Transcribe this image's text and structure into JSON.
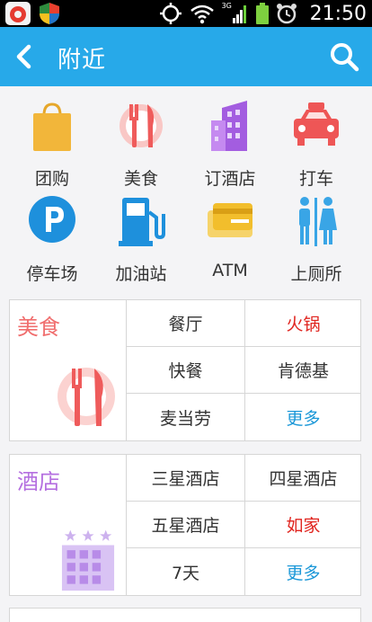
{
  "status_bar": {
    "time": "21:50",
    "network": "3G"
  },
  "title_bar": {
    "title": "附近"
  },
  "shortcuts": [
    {
      "label": "团购",
      "icon": "shopping-bag-icon"
    },
    {
      "label": "美食",
      "icon": "cutlery-icon"
    },
    {
      "label": "订酒店",
      "icon": "building-icon"
    },
    {
      "label": "打车",
      "icon": "taxi-icon"
    },
    {
      "label": "停车场",
      "icon": "parking-icon"
    },
    {
      "label": "加油站",
      "icon": "gas-station-icon"
    },
    {
      "label": "ATM",
      "icon": "atm-card-icon"
    },
    {
      "label": "上厕所",
      "icon": "restroom-icon"
    }
  ],
  "food": {
    "title": "美食",
    "items": [
      "餐厅",
      "火锅",
      "快餐",
      "肯德基",
      "麦当劳",
      "更多"
    ]
  },
  "hotel": {
    "title": "酒店",
    "items": [
      "三星酒店",
      "四星酒店",
      "五星酒店",
      "如家",
      "7天",
      "更多"
    ]
  },
  "colors": {
    "primary": "#27a9e9",
    "food": "#f06e6e",
    "hotel": "#b570e0",
    "hot": "#e0251f",
    "more": "#1c98d8"
  }
}
